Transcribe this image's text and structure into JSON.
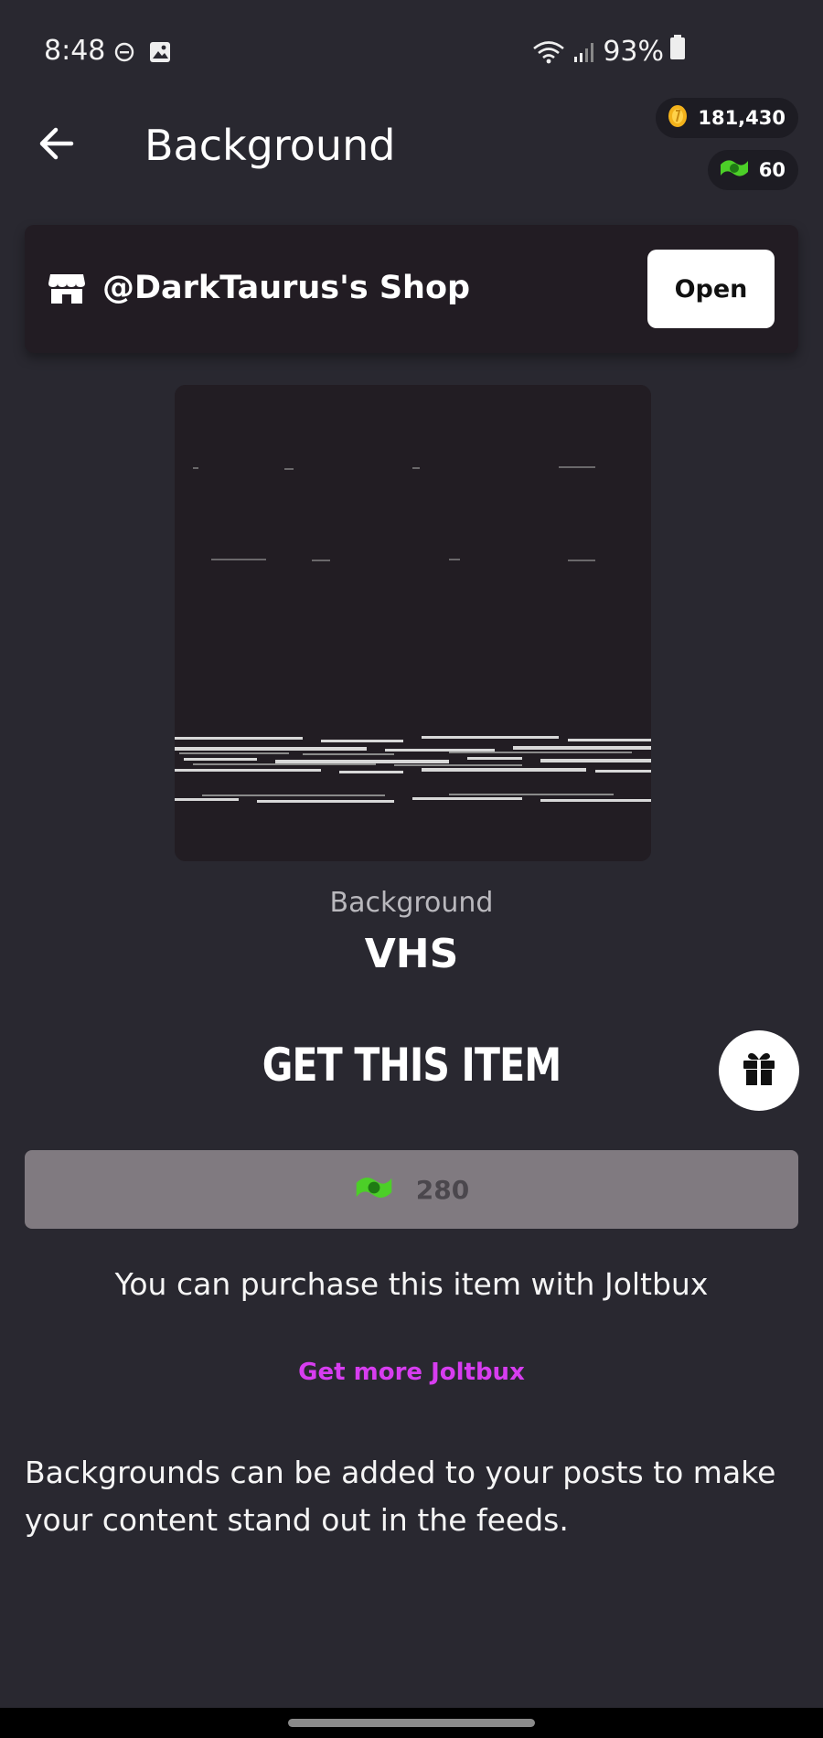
{
  "status_bar": {
    "time": "8:48",
    "battery": "93%",
    "icons": [
      "do-not-disturb-icon",
      "gallery-icon",
      "wifi-icon",
      "signal-icon",
      "battery-icon"
    ]
  },
  "header": {
    "title": "Background",
    "coins": "181,430",
    "joltbux": "60"
  },
  "shop": {
    "name": "@DarkTaurus's Shop",
    "open_label": "Open"
  },
  "item": {
    "type": "Background",
    "name": "VHS"
  },
  "purchase": {
    "heading": "GET THIS ITEM",
    "price": "280",
    "info": "You can purchase this item with Joltbux",
    "more_link": "Get more Joltbux"
  },
  "description": "Backgrounds can be added to your posts to make your content stand out in the feeds.",
  "colors": {
    "background": "#292830",
    "card": "#221c23",
    "price_button": "#807a80",
    "link": "#d73df0",
    "coin": "#f3b21b",
    "joltbux": "#4ccf28"
  }
}
